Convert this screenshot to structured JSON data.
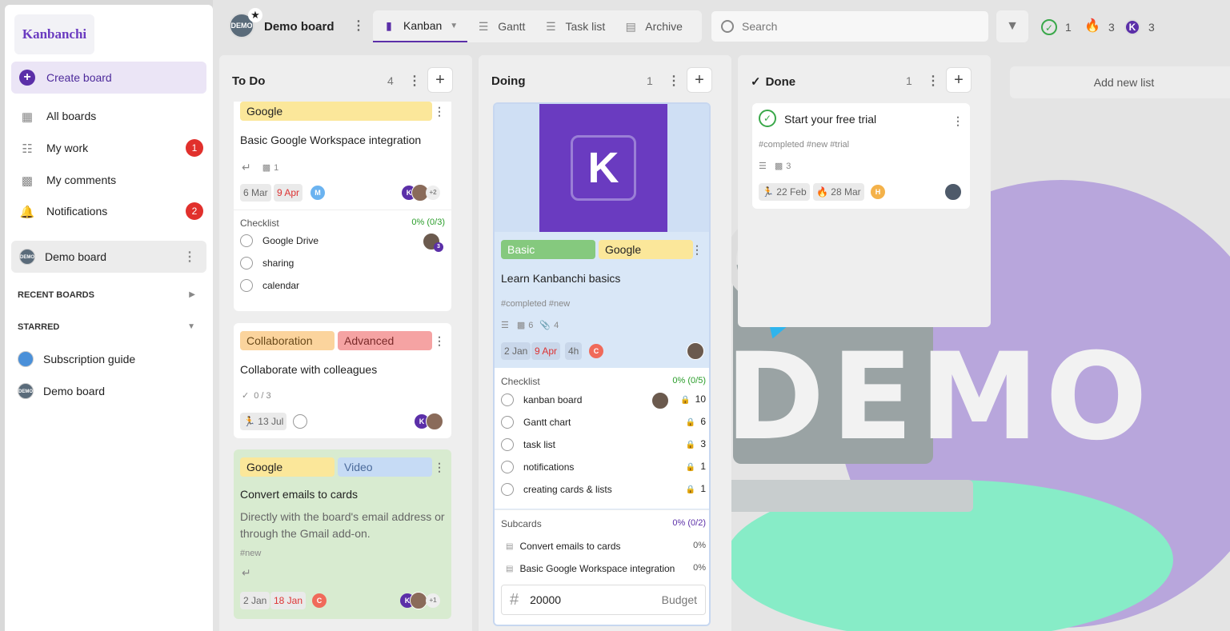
{
  "app": {
    "logo_text": "Kanbanchi"
  },
  "sidebar": {
    "create_label": "Create board",
    "nav": [
      {
        "label": "All boards",
        "icon": "boards-icon",
        "badge": ""
      },
      {
        "label": "My work",
        "icon": "my-work-icon",
        "badge": "1"
      },
      {
        "label": "My comments",
        "icon": "comments-icon",
        "badge": ""
      },
      {
        "label": "Notifications",
        "icon": "bell-icon",
        "badge": "2"
      }
    ],
    "current_board": "Demo board",
    "recent_title": "RECENT BOARDS",
    "starred_title": "STARRED",
    "starred": [
      "Subscription guide",
      "Demo board"
    ]
  },
  "topbar": {
    "board_title": "Demo board",
    "board_icon_text": "DEMO",
    "tabs": [
      {
        "label": "Kanban",
        "icon": "kanban-icon"
      },
      {
        "label": "Gantt",
        "icon": "gantt-icon"
      },
      {
        "label": "Task list",
        "icon": "task-list-icon"
      },
      {
        "label": "Archive",
        "icon": "archive-icon"
      }
    ],
    "search_placeholder": "Search",
    "stats": {
      "done": "1",
      "priority": "3",
      "k": "3"
    }
  },
  "lists": {
    "todo": {
      "title": "To Do",
      "count": "4"
    },
    "doing": {
      "title": "Doing",
      "count": "1"
    },
    "done": {
      "title": "Done",
      "count": "1"
    },
    "add_new": "Add new list"
  },
  "cards": {
    "c1": {
      "tag1": "Google",
      "title": "Basic Google Workspace integration",
      "comments": "1",
      "start": "6 Mar",
      "due": "9 Apr",
      "avatar": "M",
      "more": "+2",
      "checklist_title": "Checklist",
      "checklist_pct": "0% (0/3)",
      "items": [
        "Google Drive",
        "sharing",
        "calendar"
      ],
      "item_badge": "3"
    },
    "c2": {
      "tag1": "Collaboration",
      "tag2": "Advanced",
      "title": "Collaborate with colleagues",
      "progress": "0 / 3",
      "start": "13 Jul"
    },
    "c3": {
      "tag1": "Google",
      "tag2": "Video",
      "title": "Convert emails to cards",
      "description": "Directly with the board's email address or through the Gmail add-on.",
      "tags": "#new",
      "start": "2 Jan",
      "due": "18 Jan",
      "avatar": "C",
      "more": "+1"
    },
    "c4": {
      "cover_letter": "K",
      "tag1": "Basic",
      "tag2": "Google",
      "title": "Learn Kanbanchi basics",
      "tags": "#completed #new",
      "comments": "6",
      "attachments": "4",
      "start": "2 Jan",
      "due": "9 Apr",
      "estimate": "4h",
      "avatar": "C",
      "checklist_title": "Checklist",
      "checklist_pct": "0% (0/5)",
      "items": [
        {
          "label": "kanban board",
          "value": "10"
        },
        {
          "label": "Gantt chart",
          "value": "6"
        },
        {
          "label": "task list",
          "value": "3"
        },
        {
          "label": "notifications",
          "value": "1"
        },
        {
          "label": "creating cards & lists",
          "value": "1"
        }
      ],
      "subcards_title": "Subcards",
      "subcards_pct": "0% (0/2)",
      "subcards": [
        {
          "label": "Convert emails to cards",
          "value": "0%"
        },
        {
          "label": "Basic Google Workspace integration",
          "value": "0%"
        }
      ],
      "budget_value": "20000",
      "budget_label": "Budget"
    },
    "c5": {
      "title": "Start your free trial",
      "tags": "#completed #new #trial",
      "comments": "3",
      "start": "22 Feb",
      "due": "28 Mar",
      "avatar": "H"
    }
  },
  "colors": {
    "accent": "#5b2fa8",
    "tag_google": "#fbe79a",
    "tag_collab": "#fbd49d",
    "tag_advanced": "#f5a3a3",
    "tag_video": "#c6dbf5",
    "tag_basic": "#85c97e",
    "badge_red": "#e1302c"
  },
  "background": {
    "watermark_text": "DEMO"
  }
}
